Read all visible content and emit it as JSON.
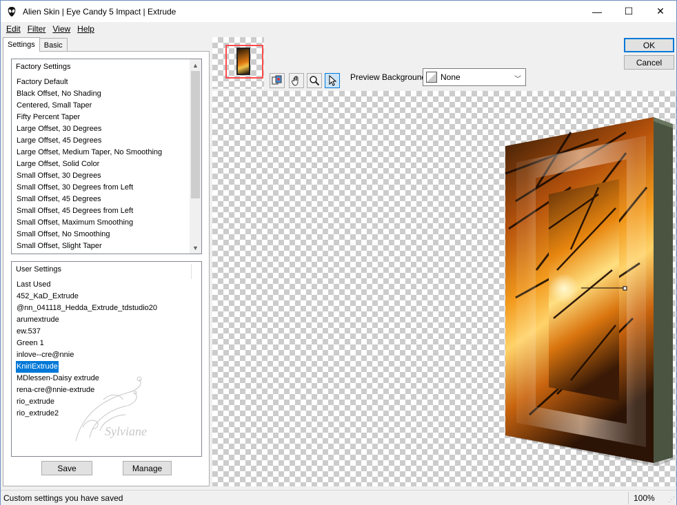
{
  "window": {
    "title": "Alien Skin | Eye Candy 5 Impact | Extrude",
    "minimize": "—",
    "maximize": "☐",
    "close": "✕"
  },
  "menu": {
    "edit": "Edit",
    "filter": "Filter",
    "view": "View",
    "help": "Help"
  },
  "tabs": {
    "settings": "Settings",
    "basic": "Basic"
  },
  "factory": {
    "header": "Factory Settings",
    "items": [
      "Factory Default",
      "Black Offset, No Shading",
      "Centered, Small Taper",
      "Fifty Percent Taper",
      "Large Offset, 30 Degrees",
      "Large Offset, 45 Degrees",
      "Large Offset, Medium Taper, No Smoothing",
      "Large Offset, Solid Color",
      "Small Offset, 30 Degrees",
      "Small Offset, 30 Degrees from Left",
      "Small Offset, 45 Degrees",
      "Small Offset, 45 Degrees from Left",
      "Small Offset, Maximum Smoothing",
      "Small Offset, No Smoothing",
      "Small Offset, Slight Taper"
    ]
  },
  "user": {
    "header": "User Settings",
    "items": [
      "Last Used",
      "452_KaD_Extrude",
      "@nn_041118_Hedda_Extrude_tdstudio20",
      "arumextrude",
      "ew.537",
      "Green 1",
      "inlove--cre@nnie",
      "KniriExtrude",
      "MDlessen-Daisy extrude",
      "rena-cre@nnie-extrude",
      "rio_extrude",
      "rio_extrude2"
    ],
    "selected_index": 7,
    "watermark": "Sylviane"
  },
  "buttons": {
    "save": "Save",
    "manage": "Manage",
    "ok": "OK",
    "cancel": "Cancel"
  },
  "preview_bg": {
    "label": "Preview Background:",
    "value": "None"
  },
  "status": {
    "text": "Custom settings you have saved",
    "zoom": "100%"
  },
  "colors": {
    "selection": "#0078d7",
    "thumb_frame": "#ff4a4a",
    "extrude_side": "#4a5440"
  }
}
